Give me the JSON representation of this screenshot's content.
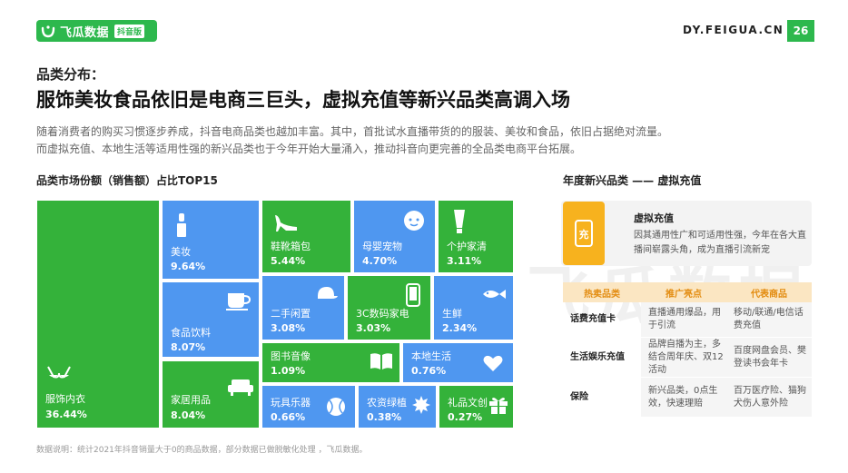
{
  "header": {
    "logo_text": "飞瓜数据",
    "logo_badge": "抖音版",
    "site": "DY.FEIGUA.CN",
    "page_number": "26",
    "brand_color": "#2db84d"
  },
  "section_label": "品类分布：",
  "headline": "服饰美妆食品依旧是电商三巨头，虚拟充值等新兴品类高调入场",
  "paragraph": {
    "line1": "随着消费者的购买习惯逐步养成，抖音电商品类也越加丰富。其中，首批试水直播带货的的服装、美妆和食品，依旧占据绝对流量。",
    "line2": "而虚拟充值、本地生活等适用性强的新兴品类也于今年开始大量涌入，推动抖音向更完善的全品类电商平台拓展。"
  },
  "chart_data": {
    "type": "treemap",
    "title": "品类市场份额（销售额）占比TOP15",
    "items": [
      {
        "name": "服饰内衣",
        "value": 36.44,
        "label": "36.44%",
        "color": "#34b23a",
        "icon": "bra-icon"
      },
      {
        "name": "美妆",
        "value": 9.64,
        "label": "9.64%",
        "color": "#4f97f0",
        "icon": "lipstick-icon"
      },
      {
        "name": "食品饮料",
        "value": 8.07,
        "label": "8.07%",
        "color": "#4f97f0",
        "icon": "cup-icon"
      },
      {
        "name": "家居用品",
        "value": 8.04,
        "label": "8.04%",
        "color": "#34b23a",
        "icon": "sofa-icon"
      },
      {
        "name": "鞋靴箱包",
        "value": 5.44,
        "label": "5.44%",
        "color": "#34b23a",
        "icon": "heel-icon"
      },
      {
        "name": "母婴宠物",
        "value": 4.7,
        "label": "4.70%",
        "color": "#4f97f0",
        "icon": "baby-icon"
      },
      {
        "name": "个护家清",
        "value": 3.11,
        "label": "3.11%",
        "color": "#34b23a",
        "icon": "tube-icon"
      },
      {
        "name": "二手闲置",
        "value": 3.08,
        "label": "3.08%",
        "color": "#4f97f0",
        "icon": "cap-icon"
      },
      {
        "name": "3C数码家电",
        "value": 3.03,
        "label": "3.03%",
        "color": "#34b23a",
        "icon": "phone-icon"
      },
      {
        "name": "生鲜",
        "value": 2.34,
        "label": "2.34%",
        "color": "#4f97f0",
        "icon": "fish-icon"
      },
      {
        "name": "图书音像",
        "value": 1.09,
        "label": "1.09%",
        "color": "#34b23a",
        "icon": "book-icon"
      },
      {
        "name": "本地生活",
        "value": 0.76,
        "label": "0.76%",
        "color": "#4f97f0",
        "icon": "heart-icon"
      },
      {
        "name": "玩具乐器",
        "value": 0.66,
        "label": "0.66%",
        "color": "#4f97f0",
        "icon": "ball-icon"
      },
      {
        "name": "农资绿植",
        "value": 0.38,
        "label": "0.38%",
        "color": "#4f97f0",
        "icon": "leaf-icon"
      },
      {
        "name": "礼品文创",
        "value": 0.27,
        "label": "0.27%",
        "color": "#34b23a",
        "icon": "gift-icon"
      }
    ]
  },
  "side": {
    "title": "年度新兴品类 —— 虚拟充值",
    "card_name": "虚拟充值",
    "card_desc": "因其通用性广和可适用性强，今年在各大直播间崭露头角，成为直播引流新宠",
    "headers": [
      "热卖品类",
      "推广亮点",
      "代表商品"
    ],
    "rows": [
      [
        "话费充值卡",
        "直播通用爆品，用于引流",
        "移动/联通/电信话费充值"
      ],
      [
        "生活娱乐充值",
        "品牌自播为主，多结合周年庆、双12活动",
        "百度网盘会员、樊登读书会年卡"
      ],
      [
        "保险",
        "新兴品类，0点生效，快速理赔",
        "百万医疗险、猫狗犬伤人意外险"
      ]
    ],
    "accent_color": "#f7b21e"
  },
  "note": "数据说明：统计2021年抖音销量大于0的商品数据，部分数据已做脱敏化处理 ，飞瓜数据。",
  "watermark": "飞瓜数据"
}
